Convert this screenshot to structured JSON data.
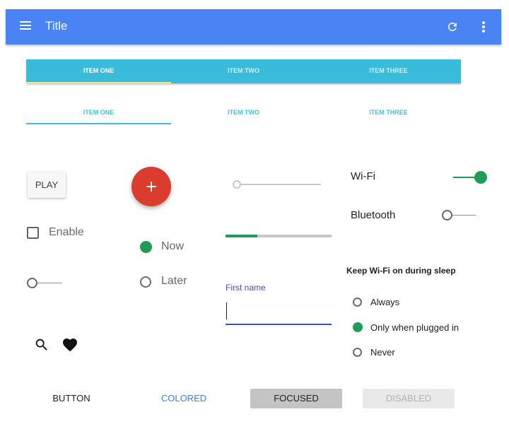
{
  "app_bar": {
    "title": "Title",
    "color": "#4a84f4",
    "icons": [
      "menu-icon",
      "refresh-icon",
      "more-vert-icon"
    ]
  },
  "tabs_filled": {
    "items": [
      {
        "label": "ITEM ONE",
        "active": true
      },
      {
        "label": "ITEM TWO",
        "active": false
      },
      {
        "label": "ITEM THREE",
        "active": false
      }
    ],
    "color": "#38bcda"
  },
  "tabs_plain": {
    "items": [
      {
        "label": "ITEM ONE",
        "active": true
      },
      {
        "label": "ITEM TWO",
        "active": false
      },
      {
        "label": "ITEM THREE",
        "active": false
      }
    ]
  },
  "controls": {
    "play_label": "PLAY",
    "fab_icon": "add-icon",
    "checkbox": {
      "label": "Enable",
      "checked": false
    },
    "switch_left": {
      "on": false
    },
    "radio_group": [
      {
        "label": "Now",
        "selected": true
      },
      {
        "label": "Later",
        "selected": false
      }
    ],
    "slider": {
      "value": 0
    },
    "progress": {
      "value": 0.3
    },
    "text_field": {
      "label": "First name",
      "value": ""
    },
    "icons": [
      "search-icon",
      "heart-icon"
    ]
  },
  "settings": {
    "wifi": {
      "label": "Wi-Fi",
      "on": true
    },
    "bluetooth": {
      "label": "Bluetooth",
      "on": false
    },
    "sleep_title": "Keep Wi-Fi on during sleep",
    "sleep_options": [
      {
        "label": "Always",
        "selected": false
      },
      {
        "label": "Only when plugged in",
        "selected": true
      },
      {
        "label": "Never",
        "selected": false
      }
    ]
  },
  "buttons": {
    "plain": "BUTTON",
    "colored": "COLORED",
    "focused": "FOCUSED",
    "disabled": "DISABLED"
  },
  "accent_colors": {
    "green": "#1e9c58",
    "red": "#db3c2e",
    "indigo": "#3d50b5"
  }
}
